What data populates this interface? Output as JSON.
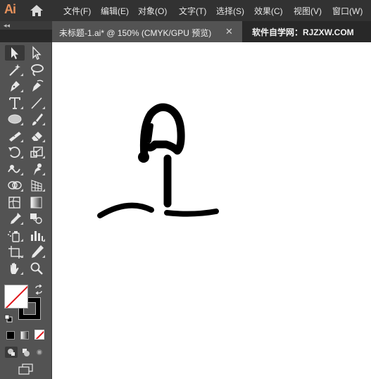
{
  "app": {
    "logo": "Ai"
  },
  "menu": {
    "items": [
      {
        "label": "文件(F)"
      },
      {
        "label": "编辑(E)"
      },
      {
        "label": "对象(O)"
      },
      {
        "label": "文字(T)"
      },
      {
        "label": "选择(S)"
      },
      {
        "label": "效果(C)"
      },
      {
        "label": "视图(V)"
      },
      {
        "label": "窗口(W)"
      }
    ]
  },
  "panel": {
    "collapse_glyph": "◂◂"
  },
  "tab": {
    "title": "未标题-1.ai* @ 150% (CMYK/GPU 预览)",
    "close": "✕"
  },
  "watermark": "软件自学网：RJZXW.COM",
  "tools": [
    {
      "name": "selection-tool-icon"
    },
    {
      "name": "direct-selection-tool-icon"
    },
    {
      "name": "magic-wand-tool-icon"
    },
    {
      "name": "lasso-tool-icon"
    },
    {
      "name": "pen-tool-icon"
    },
    {
      "name": "curvature-tool-icon"
    },
    {
      "name": "type-tool-icon"
    },
    {
      "name": "line-segment-tool-icon"
    },
    {
      "name": "ellipse-tool-icon"
    },
    {
      "name": "paintbrush-tool-icon"
    },
    {
      "name": "shaper-tool-icon"
    },
    {
      "name": "eraser-tool-icon"
    },
    {
      "name": "rotate-tool-icon"
    },
    {
      "name": "scale-tool-icon"
    },
    {
      "name": "warp-tool-icon"
    },
    {
      "name": "puppet-warp-tool-icon"
    },
    {
      "name": "shape-builder-tool-icon"
    },
    {
      "name": "perspective-grid-tool-icon"
    },
    {
      "name": "mesh-tool-icon"
    },
    {
      "name": "gradient-tool-icon"
    },
    {
      "name": "eyedropper-tool-icon"
    },
    {
      "name": "blend-tool-icon"
    },
    {
      "name": "symbol-sprayer-tool-icon"
    },
    {
      "name": "column-graph-tool-icon"
    },
    {
      "name": "artboard-tool-icon"
    },
    {
      "name": "slice-tool-icon"
    },
    {
      "name": "hand-tool-icon"
    },
    {
      "name": "zoom-tool-icon"
    }
  ],
  "colors": {
    "menubar": "#323232",
    "tabrow": "#282828",
    "panel": "#535353",
    "canvas": "#ffffff",
    "logo": "#e8925c",
    "stroke": "#000000",
    "none_slash": "#e0161b"
  }
}
